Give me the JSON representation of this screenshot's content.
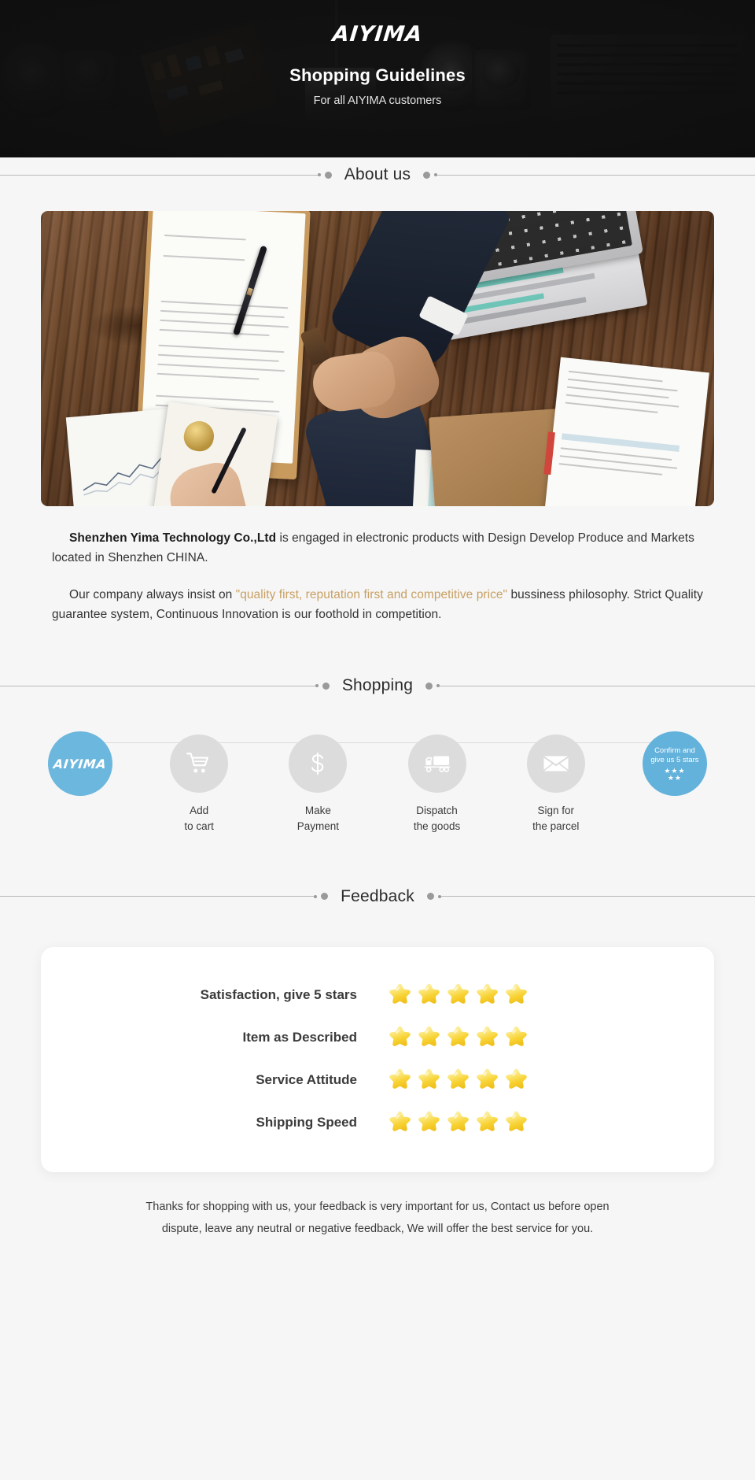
{
  "banner": {
    "logo": "AIYIMA",
    "title": "Shopping Guidelines",
    "subtitle": "For all AIYIMA customers"
  },
  "sections": {
    "about": "About us",
    "shopping": "Shopping",
    "feedback": "Feedback"
  },
  "about": {
    "paragraph1_bold": "Shenzhen Yima Technology Co.,Ltd",
    "paragraph1_rest": " is engaged in electronic products with Design Develop Produce and Markets located in Shenzhen CHINA.",
    "paragraph2_pre": "Our company always insist on ",
    "paragraph2_quote": "\"quality first, reputation first and competitive price\"",
    "paragraph2_post": " bussiness philosophy. Strict Quality guarantee system, Continuous Innovation is our foothold in competition.",
    "accent_color": "#c8a063"
  },
  "shopping": {
    "brand_color": "#6cb7dd",
    "bubble_color": "#dcdcdc",
    "steps": [
      {
        "icon": "aiyima-logo-icon",
        "logo": "AIYIMA",
        "label_line1": "",
        "label_line2": ""
      },
      {
        "icon": "shopping-cart-icon",
        "label_line1": "Add",
        "label_line2": "to cart"
      },
      {
        "icon": "dollar-sign-icon",
        "label_line1": "Make",
        "label_line2": "Payment"
      },
      {
        "icon": "delivery-truck-icon",
        "label_line1": "Dispatch",
        "label_line2": "the goods"
      },
      {
        "icon": "envelope-icon",
        "label_line1": "Sign for",
        "label_line2": "the parcel"
      },
      {
        "icon": "five-stars-icon",
        "final_line1": "Confirm and",
        "final_line2": "give us 5 stars",
        "stars_row1": "★★★",
        "stars_row2": "★★"
      }
    ]
  },
  "feedback": {
    "rows": [
      {
        "label": "Satisfaction, give 5 stars",
        "stars": 5
      },
      {
        "label": "Item as Described",
        "stars": 5
      },
      {
        "label": "Service Attitude",
        "stars": 5
      },
      {
        "label": "Shipping Speed",
        "stars": 5
      }
    ],
    "star_color": "#f7d33f"
  },
  "footer": {
    "line1": "Thanks for shopping with us, your feedback is very important for us, Contact us before open",
    "line2": "dispute, leave any neutral or negative feedback, We will offer the best service for you."
  }
}
